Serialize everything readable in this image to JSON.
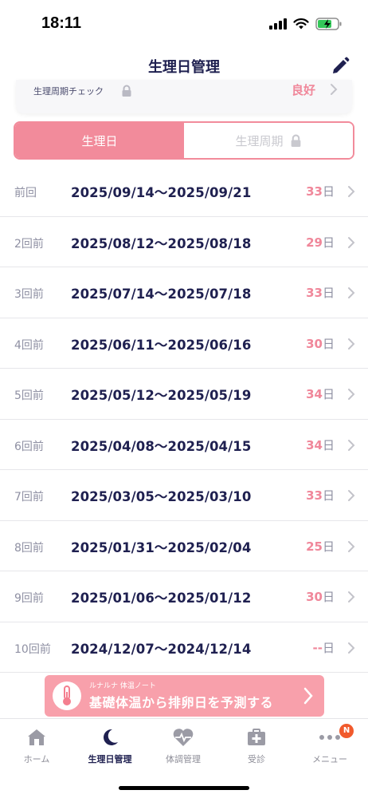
{
  "status_bar": {
    "time": "18:11"
  },
  "header": {
    "title": "生理日管理"
  },
  "cycle_check": {
    "label": "生理周期チェック",
    "status": "良好"
  },
  "segments": {
    "active": "生理日",
    "inactive": "生理周期"
  },
  "periods": [
    {
      "label": "前回",
      "dates": "2025/09/14～2025/09/21",
      "length": "33",
      "unit": "日"
    },
    {
      "label": "2回前",
      "dates": "2025/08/12～2025/08/18",
      "length": "29",
      "unit": "日"
    },
    {
      "label": "3回前",
      "dates": "2025/07/14～2025/07/18",
      "length": "33",
      "unit": "日"
    },
    {
      "label": "4回前",
      "dates": "2025/06/11～2025/06/16",
      "length": "30",
      "unit": "日"
    },
    {
      "label": "5回前",
      "dates": "2025/05/12～2025/05/19",
      "length": "34",
      "unit": "日"
    },
    {
      "label": "6回前",
      "dates": "2025/04/08～2025/04/15",
      "length": "34",
      "unit": "日"
    },
    {
      "label": "7回前",
      "dates": "2025/03/05～2025/03/10",
      "length": "33",
      "unit": "日"
    },
    {
      "label": "8回前",
      "dates": "2025/01/31～2025/02/04",
      "length": "25",
      "unit": "日"
    },
    {
      "label": "9回前",
      "dates": "2025/01/06～2025/01/12",
      "length": "30",
      "unit": "日"
    },
    {
      "label": "10回前",
      "dates": "2024/12/07～2024/12/14",
      "length": "--",
      "unit": "日"
    }
  ],
  "banner": {
    "sub": "ルナルナ 体温ノート",
    "main": "基礎体温から排卵日を予測する"
  },
  "tabbar": {
    "tabs": [
      {
        "label": "ホーム",
        "icon": "home-icon"
      },
      {
        "label": "生理日管理",
        "icon": "moon-icon"
      },
      {
        "label": "体調管理",
        "icon": "heart-pulse-icon"
      },
      {
        "label": "受診",
        "icon": "medical-kit-icon"
      },
      {
        "label": "メニュー",
        "icon": "more-icon"
      }
    ],
    "badge": "N"
  },
  "colors": {
    "accent": "#f28b9b",
    "navy": "#1f2050",
    "badge": "#f15a2c"
  }
}
